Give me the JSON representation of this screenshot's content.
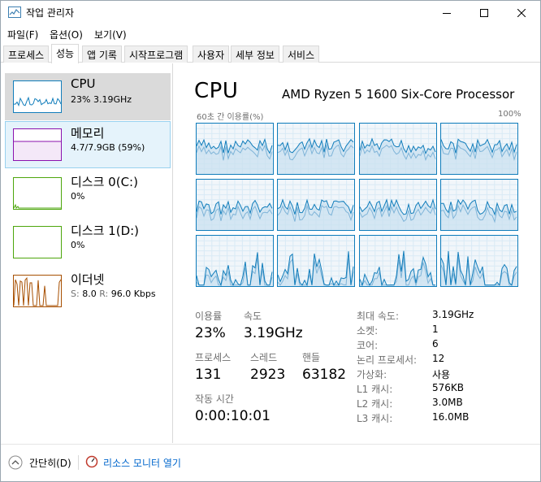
{
  "window": {
    "title": "작업 관리자"
  },
  "menu": {
    "items": [
      "파일(F)",
      "옵션(O)",
      "보기(V)"
    ]
  },
  "tabs": [
    {
      "label": "프로세스",
      "active": false
    },
    {
      "label": "성능",
      "active": true
    },
    {
      "label": "앱 기록",
      "active": false
    },
    {
      "label": "시작프로그램",
      "active": false
    },
    {
      "label": "사용자",
      "active": false
    },
    {
      "label": "세부 정보",
      "active": false
    },
    {
      "label": "서비스",
      "active": false
    }
  ],
  "resources": [
    {
      "name": "CPU",
      "detail": "23% 3.19GHz",
      "color": "#117dbb",
      "state": "selected"
    },
    {
      "name": "메모리",
      "detail": "4.7/7.9GB (59%)",
      "color": "#8b12ae",
      "state": "hover"
    },
    {
      "name": "디스크 0(C:)",
      "detail": "0%",
      "color": "#4da60c",
      "state": "normal"
    },
    {
      "name": "디스크 1(D:)",
      "detail": "0%",
      "color": "#4da60c",
      "state": "normal"
    },
    {
      "name": "이더넷",
      "detail_send_label": "S:",
      "detail_send": "8.0",
      "detail_recv_label": "R:",
      "detail_recv": "96.0 Kbps",
      "color": "#a74f01",
      "state": "normal"
    }
  ],
  "main": {
    "title": "CPU",
    "processor": "AMD Ryzen 5 1600 Six-Core Processor",
    "graph_label": "60초 간 이용률(%)",
    "graph_max": "100%",
    "accent": "#117dbb",
    "core_count_shown": 12,
    "stats": {
      "utilization_label": "이용률",
      "utilization": "23%",
      "speed_label": "속도",
      "speed": "3.19GHz",
      "processes_label": "프로세스",
      "processes": "131",
      "threads_label": "스레드",
      "threads": "2923",
      "handles_label": "핸들",
      "handles": "63182",
      "uptime_label": "작동 시간",
      "uptime": "0:00:10:01"
    },
    "info": [
      {
        "label": "최대 속도:",
        "value": "3.19GHz"
      },
      {
        "label": "소켓:",
        "value": "1"
      },
      {
        "label": "코어:",
        "value": "6"
      },
      {
        "label": "논리 프로세서:",
        "value": "12"
      },
      {
        "label": "가상화:",
        "value": "사용"
      },
      {
        "label": "L1 캐시:",
        "value": "576KB"
      },
      {
        "label": "L2 캐시:",
        "value": "3.0MB"
      },
      {
        "label": "L3 캐시:",
        "value": "16.0MB"
      }
    ]
  },
  "footer": {
    "collapse_label": "간단히(D)",
    "monitor_label": "리소스 모니터 열기",
    "icons": [
      "chevron-up-icon",
      "resource-monitor-icon"
    ]
  }
}
